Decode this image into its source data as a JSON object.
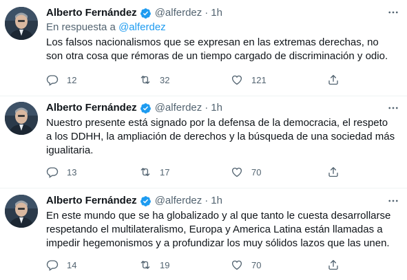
{
  "tweets": [
    {
      "name": "Alberto Fernández",
      "handle": "@alferdez",
      "dot": "·",
      "time": "1h",
      "reply_prefix": "En respuesta a",
      "reply_handle": "@alferdez",
      "text_lines": [
        "Los falsos nacionalismos que se expresan en las extremas derechas, no",
        "son otra cosa que rémoras de un tiempo cargado de discriminación y odio."
      ],
      "replies": "12",
      "retweets": "32",
      "likes": "121"
    },
    {
      "name": "Alberto Fernández",
      "handle": "@alferdez",
      "dot": "·",
      "time": "1h",
      "text_lines": [
        "Nuestro presente está signado por la defensa de la democracia, el respeto",
        "a los DDHH, la ampliación de derechos y la búsqueda de una sociedad más",
        "igualitaria."
      ],
      "replies": "13",
      "retweets": "17",
      "likes": "70"
    },
    {
      "name": "Alberto Fernández",
      "handle": "@alferdez",
      "dot": "·",
      "time": "1h",
      "text_lines": [
        "En este mundo que se ha globalizado y al que tanto le cuesta desarrollarse",
        "respetando el multilateralismo, Europa y America Latina están llamadas a",
        "impedir hegemonismos y a profundizar los muy sólidos lazos que las unen."
      ],
      "replies": "14",
      "retweets": "19",
      "likes": "70"
    }
  ],
  "colors": {
    "primary_text": "#0f1419",
    "secondary_text": "#536471",
    "link": "#1d9bf0",
    "verified": "#1d9bf0",
    "divider": "#eff3f4"
  },
  "icons": {
    "more": "more-horizontal-icon",
    "verified": "verified-badge-icon",
    "reply": "reply-icon",
    "retweet": "retweet-icon",
    "like": "heart-icon",
    "share": "share-icon"
  }
}
